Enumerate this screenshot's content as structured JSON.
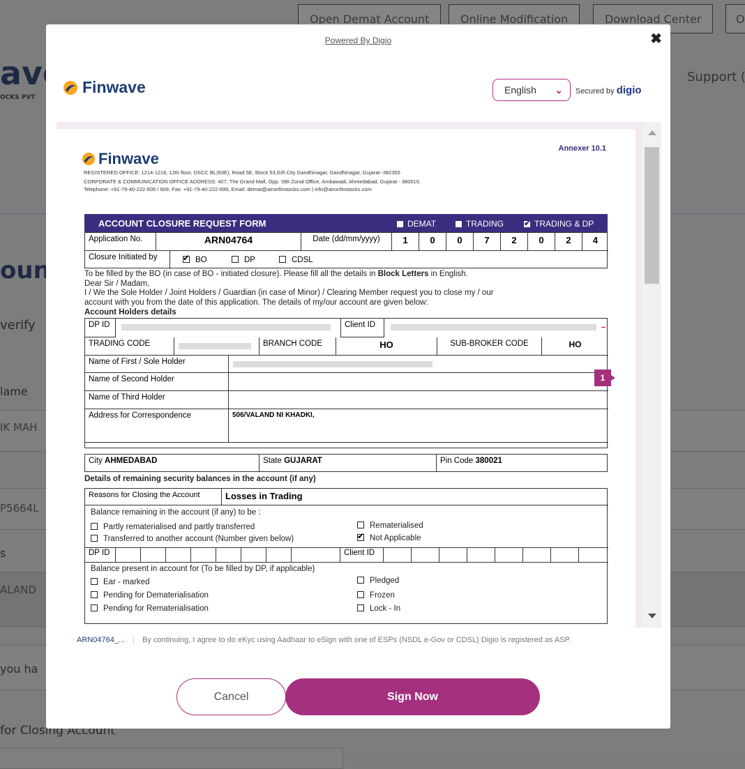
{
  "background": {
    "nav_buttons": [
      "Open Demat Account",
      "Online Modification",
      "Download Center"
    ],
    "brand_fragment": "ave",
    "brand_sub": "OCKS PVT",
    "support": "Support (",
    "heading_fragment": "oun",
    "verify_fragment": "verify",
    "name_label_fragment": "lame",
    "name_value_fragment": "IK MAH",
    "pan_fragment": "P5664L",
    "s_fragment": "s",
    "address_fragment": "ALAND",
    "you_fragment": "you ha",
    "closing_label": "for Closing Account"
  },
  "modal": {
    "powered_by": "Powered By Digio",
    "brand": "Finwave",
    "language": "English",
    "secured_by": "Secured by",
    "secured_brand": "digio",
    "footer_ref": "ARN04764_...",
    "footer_text": "By continuing, I agree to do eKyc using Aadhaar to eSign with one of ESPs (NSDL e-Gov or CDSL) Digio is registered as ASP.",
    "cancel_label": "Cancel",
    "sign_label": "Sign Now",
    "pin_number": "1"
  },
  "doc": {
    "annexure": "Annexer 10.1",
    "brand": "Finwave",
    "address_line1": "REGISTERED OFFICE: 1214-1216, 12th floor, DSCC BL(63E), Road 5E, Block 53,Gift City Gandhinagar, Gandhinagar, Gujarat.-382355",
    "address_line2": "CORPORATE & COMMUNICATION OFFICE ADDRESS: 407, The Grand Mall, Opp. SBI Zonal Office, Ambawadi, Ahmedabad, Gujarat - 380015.",
    "address_line3": "Telephone: +91-79-40-222-605 / 609, Fax: +91-79-40-222-699, Email: demat@aironfinstocks.com | info@aironfinstocks.com",
    "form_title": "ACCOUNT CLOSURE REQUEST FORM",
    "opt_demat": "DEMAT",
    "opt_trading": "TRADING",
    "opt_trading_dp": "TRADING & DP",
    "app_no_label": "Application No.",
    "app_no": "ARN04764",
    "date_label": "Date (dd/mm/yyyy)",
    "date_digits": [
      "1",
      "0",
      "0",
      "7",
      "2",
      "0",
      "2",
      "4"
    ],
    "closure_label": "Closure Initiated by",
    "opt_bo": "BO",
    "opt_dp": "DP",
    "opt_cdsl": "CDSL",
    "instr1": "To be filled by the BO (in case of BO - initiated closure). Please fill all the details in",
    "instr1_bold": "Block Letters",
    "instr1_end": "in English.",
    "dear": "Dear Sir / Madam,",
    "para1": "I / We the Sole Holder / Joint Holders / Guardian (in case of Minor) / Clearing Member request you to close my / our",
    "para2": "account with you from the date of this application. The details of my/our account are given below:",
    "holders_heading": "Account Holders details",
    "dp_id_label": "DP ID",
    "client_id_label": "Client ID",
    "trading_code_label": "TRADING CODE",
    "branch_code_label": "BRANCH CODE",
    "branch_code": "HO",
    "sub_broker_label": "SUB-BROKER CODE",
    "sub_broker": "HO",
    "first_holder_label": "Name of First / Sole Holder",
    "second_holder_label": "Name of Second Holder",
    "third_holder_label": "Name of Third Holder",
    "address_label": "Address for Correspondence",
    "address_value": "506/VALAND NI KHADKI,",
    "city_label": "City",
    "city": "AHMEDABAD",
    "state_label": "State",
    "state": "GUJARAT",
    "pin_label": "Pin Code",
    "pin": "380021",
    "balances_heading": "Details of remaining security balances in the account (if any)",
    "reasons_label": "Reasons for Closing the Account",
    "reasons": "Losses in Trading",
    "balance_label": "Balance remaining in the account (if any) to be :",
    "opt_partly": "Partly rematerialised and partly transferred",
    "opt_remat": "Rematerialised",
    "opt_transfer": "Transferred to another account (Number given below)",
    "opt_na": "Not Applicable",
    "dp_id_label2": "DP ID",
    "client_id_label2": "Client ID",
    "balance_present_label": "Balance present in account for (To be filled by DP, if applicable)",
    "opt_earmarked": "Ear - marked",
    "opt_pledged": "Pledged",
    "opt_pending_demat": "Pending for Dematerialisation",
    "opt_frozen": "Frozen",
    "opt_pending_remat": "Pending for Rematerialisation",
    "opt_lockin": "Lock - In"
  }
}
